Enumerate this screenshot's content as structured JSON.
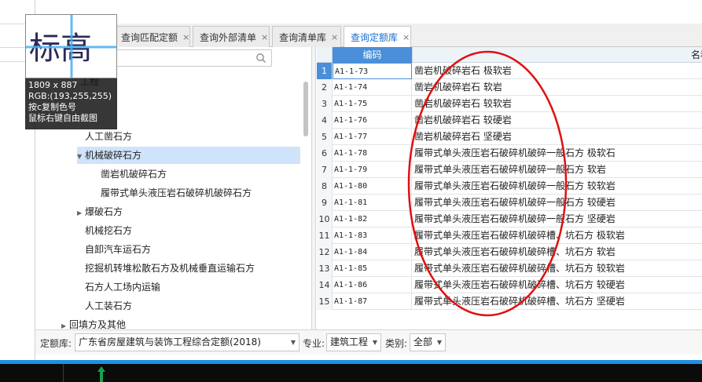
{
  "tabs": [
    {
      "label": "查询匹配定额",
      "active": false
    },
    {
      "label": "查询外部清单",
      "active": false
    },
    {
      "label": "查询清单库",
      "active": false
    },
    {
      "label": "查询定额库",
      "active": true
    }
  ],
  "tab_close_glyph": "×",
  "search": {
    "placeholder": "",
    "icon": "search-icon"
  },
  "tree": [
    {
      "label": "工程",
      "arrow": "",
      "indent": 2
    },
    {
      "label": "人工凿石方",
      "arrow": "",
      "indent": 2
    },
    {
      "label": "机械破碎石方",
      "arrow": "▼",
      "indent": 2,
      "selected": true
    },
    {
      "label": "凿岩机破碎石方",
      "arrow": "",
      "indent": 3
    },
    {
      "label": "履带式单头液压岩石破碎机破碎石方",
      "arrow": "",
      "indent": 3
    },
    {
      "label": "爆破石方",
      "arrow": "▶",
      "indent": 2
    },
    {
      "label": "机械挖石方",
      "arrow": "",
      "indent": 2
    },
    {
      "label": "自卸汽车运石方",
      "arrow": "",
      "indent": 2
    },
    {
      "label": "挖掘机转堆松散石方及机械垂直运输石方",
      "arrow": "",
      "indent": 2
    },
    {
      "label": "石方人工场内运输",
      "arrow": "",
      "indent": 2
    },
    {
      "label": "人工装石方",
      "arrow": "",
      "indent": 2
    },
    {
      "label": "回填方及其他",
      "arrow": "▶",
      "indent": 1
    }
  ],
  "grid": {
    "header_code": "编码",
    "header_name": "名称",
    "rows": [
      {
        "num": "1",
        "code": "A1-1-73",
        "name": "凿岩机破碎岩石 极软岩"
      },
      {
        "num": "2",
        "code": "A1-1-74",
        "name": "凿岩机破碎岩石 软岩"
      },
      {
        "num": "3",
        "code": "A1-1-75",
        "name": "凿岩机破碎岩石 较软岩"
      },
      {
        "num": "4",
        "code": "A1-1-76",
        "name": "凿岩机破碎岩石 较硬岩"
      },
      {
        "num": "5",
        "code": "A1-1-77",
        "name": "凿岩机破碎岩石 坚硬岩"
      },
      {
        "num": "6",
        "code": "A1-1-78",
        "name": "履带式单头液压岩石破碎机破碎一般石方 极软石"
      },
      {
        "num": "7",
        "code": "A1-1-79",
        "name": "履带式单头液压岩石破碎机破碎一般石方 软岩"
      },
      {
        "num": "8",
        "code": "A1-1-80",
        "name": "履带式单头液压岩石破碎机破碎一般石方 较软岩"
      },
      {
        "num": "9",
        "code": "A1-1-81",
        "name": "履带式单头液压岩石破碎机破碎一般石方 较硬岩"
      },
      {
        "num": "10",
        "code": "A1-1-82",
        "name": "履带式单头液压岩石破碎机破碎一般石方 坚硬岩"
      },
      {
        "num": "11",
        "code": "A1-1-83",
        "name": "履带式单头液压岩石破碎机破碎槽、坑石方 极软岩"
      },
      {
        "num": "12",
        "code": "A1-1-84",
        "name": "履带式单头液压岩石破碎机破碎槽、坑石方 软岩"
      },
      {
        "num": "13",
        "code": "A1-1-85",
        "name": "履带式单头液压岩石破碎机破碎槽、坑石方 较软岩"
      },
      {
        "num": "14",
        "code": "A1-1-86",
        "name": "履带式单头液压岩石破碎机破碎槽、坑石方 较硬岩"
      },
      {
        "num": "15",
        "code": "A1-1-87",
        "name": "履带式单头液压岩石破碎机破碎槽、坑石方 坚硬岩"
      }
    ]
  },
  "filter": {
    "library_label": "定额库:",
    "library_value": "广东省房屋建筑与装饰工程综合定额(2018)",
    "major_label": "专业:",
    "major_value": "建筑工程",
    "category_label": "类别:",
    "category_value": "全部",
    "dropdown_glyph": "▼"
  },
  "magnifier": {
    "size_text": "1809 x 887",
    "rgb_text": "RGB:(193,255,255)",
    "hint1": "按c复制色号",
    "hint2": "鼠标右键自由截图",
    "preview_text": "标高"
  },
  "colors": {
    "accent": "#4a8fd8",
    "active_tab_text": "#1a6fd0",
    "annotation_red": "#e01010",
    "selected_row": "#cfe3fb",
    "taskbar": "#0b0b0b",
    "blue_line": "#1e90e0"
  }
}
